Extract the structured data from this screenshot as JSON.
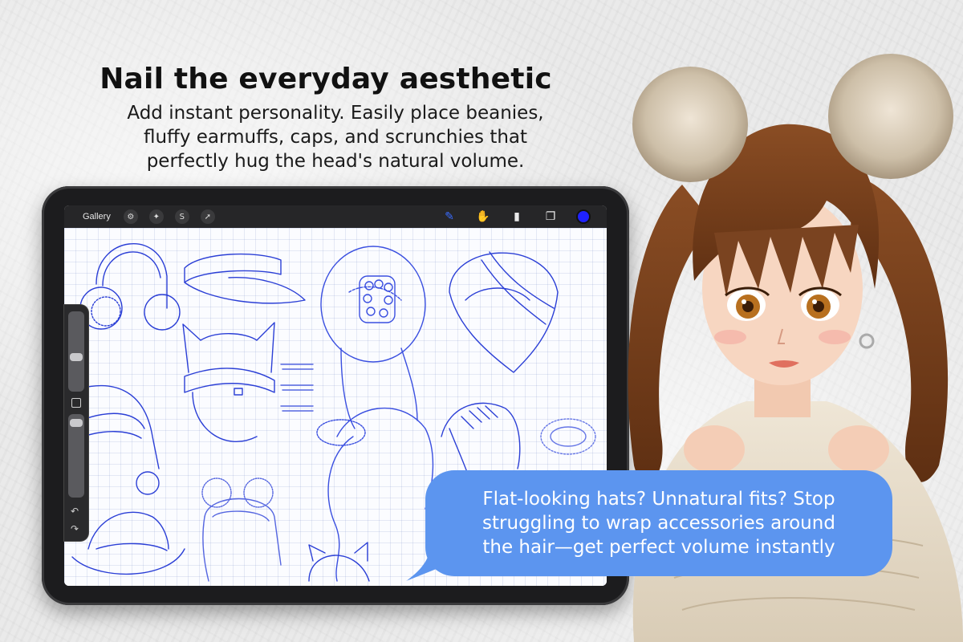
{
  "header": {
    "title": "Nail the everyday aesthetic",
    "subtitle_lines": [
      "Add instant personality. Easily place beanies,",
      "fluffy earmuffs, caps, and scrunchies that",
      "perfectly hug the head's natural volume."
    ]
  },
  "app": {
    "gallery_label": "Gallery",
    "left_tools": [
      "wrench-icon",
      "magic-wand-icon",
      "selection-icon",
      "transform-arrow-icon"
    ],
    "right_tools": [
      "brush-icon",
      "smudge-icon",
      "eraser-icon",
      "layers-icon"
    ],
    "active_color": "#1f22ff"
  },
  "callout": {
    "lines": [
      "Flat-looking hats? Unnatural fits? Stop",
      "struggling to wrap accessories around",
      "the hair—get perfect volume instantly"
    ]
  },
  "colors": {
    "bubble": "#5c95ef",
    "ink": "#2b3fd6"
  }
}
